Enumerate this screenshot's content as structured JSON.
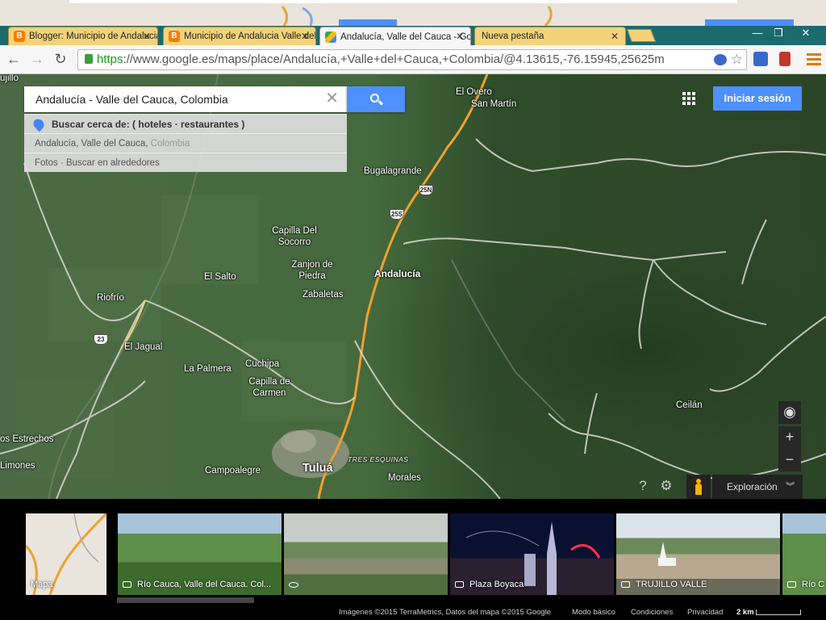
{
  "browser": {
    "tabs": [
      {
        "title": "Blogger: Municipio de Andalucia",
        "active": false
      },
      {
        "title": "Municipio de Andalucia Valle del Cauca",
        "active": false
      },
      {
        "title": "Andalucía, Valle del Cauca - Google Maps",
        "active": true
      },
      {
        "title": "Nueva pestaña",
        "active": false
      }
    ],
    "window_controls": {
      "minimize": "—",
      "maximize": "❐",
      "close": "✕"
    },
    "url_scheme": "https",
    "url_rest": "://www.google.es/maps/place/Andalucía,+Valle+del+Cauca,+Colombia/@4.13615,-76.15945,25625m"
  },
  "search": {
    "value": "Andalucía - Valle del Cauca, Colombia",
    "suggestions": {
      "nearby": "Buscar cerca de: ( hoteles · restaurantes )",
      "place_main": "Andalucía, Valle del Cauca,",
      "place_country": " Colombia",
      "photos": "Fotos · Buscar en alrededores"
    }
  },
  "header": {
    "signin_label": "Iniciar sesión"
  },
  "map": {
    "places": [
      {
        "name": "El Overo",
        "style": "normal"
      },
      {
        "name": "San Martín",
        "style": "normal"
      },
      {
        "name": "Bugalagrande",
        "style": "normal"
      },
      {
        "name": "Capilla Del Socorro",
        "style": "normal"
      },
      {
        "name": "Zanjon de Piedra",
        "style": "normal"
      },
      {
        "name": "Zabaletas",
        "style": "normal"
      },
      {
        "name": "Andalucía",
        "style": "bold"
      },
      {
        "name": "El Salto",
        "style": "normal"
      },
      {
        "name": "Riofrío",
        "style": "normal"
      },
      {
        "name": "El Jagual",
        "style": "normal"
      },
      {
        "name": "La Palmera",
        "style": "normal"
      },
      {
        "name": "Cuchipa",
        "style": "normal"
      },
      {
        "name": "Capilla de Carmen",
        "style": "normal"
      },
      {
        "name": "Ceilán",
        "style": "normal"
      },
      {
        "name": "Tuluá",
        "style": "big"
      },
      {
        "name": "Campoalegre",
        "style": "normal"
      },
      {
        "name": "Morales",
        "style": "normal"
      },
      {
        "name": "os Estrechos",
        "style": "normal"
      },
      {
        "name": "Limones",
        "style": "normal"
      },
      {
        "name": "TRES ESQUINAS",
        "style": "road"
      },
      {
        "name": "ujillo",
        "style": "normal"
      }
    ],
    "shields": [
      "25N",
      "25S",
      "23"
    ],
    "controls": {
      "explore_label": "Exploración",
      "zoom_in": "+",
      "zoom_out": "−",
      "help": "?",
      "settings": "⚙"
    }
  },
  "strip": {
    "cards": [
      {
        "label": "Mapa",
        "icon": "none"
      },
      {
        "label": "Río Cauca, Valle del Cauca. Col...",
        "icon": "camera-icon"
      },
      {
        "label": "",
        "icon": "photosphere-icon"
      },
      {
        "label": "Plaza Boyaca",
        "icon": "camera-icon"
      },
      {
        "label": "TRUJILLO VALLE",
        "icon": "camera-icon"
      },
      {
        "label": "Río C",
        "icon": "camera-icon"
      }
    ],
    "footer": {
      "attribution": "Imágenes ©2015 TerraMetrics, Datos del mapa ©2015 Google",
      "basic_mode": "Modo básico",
      "terms": "Condiciones",
      "privacy": "Privacidad",
      "scale": "2 km"
    }
  },
  "colors": {
    "accent_blue": "#4d90fe",
    "tab_strip": "#1b6a6e",
    "tab": "#f4d27a",
    "road": "#f0a030"
  }
}
